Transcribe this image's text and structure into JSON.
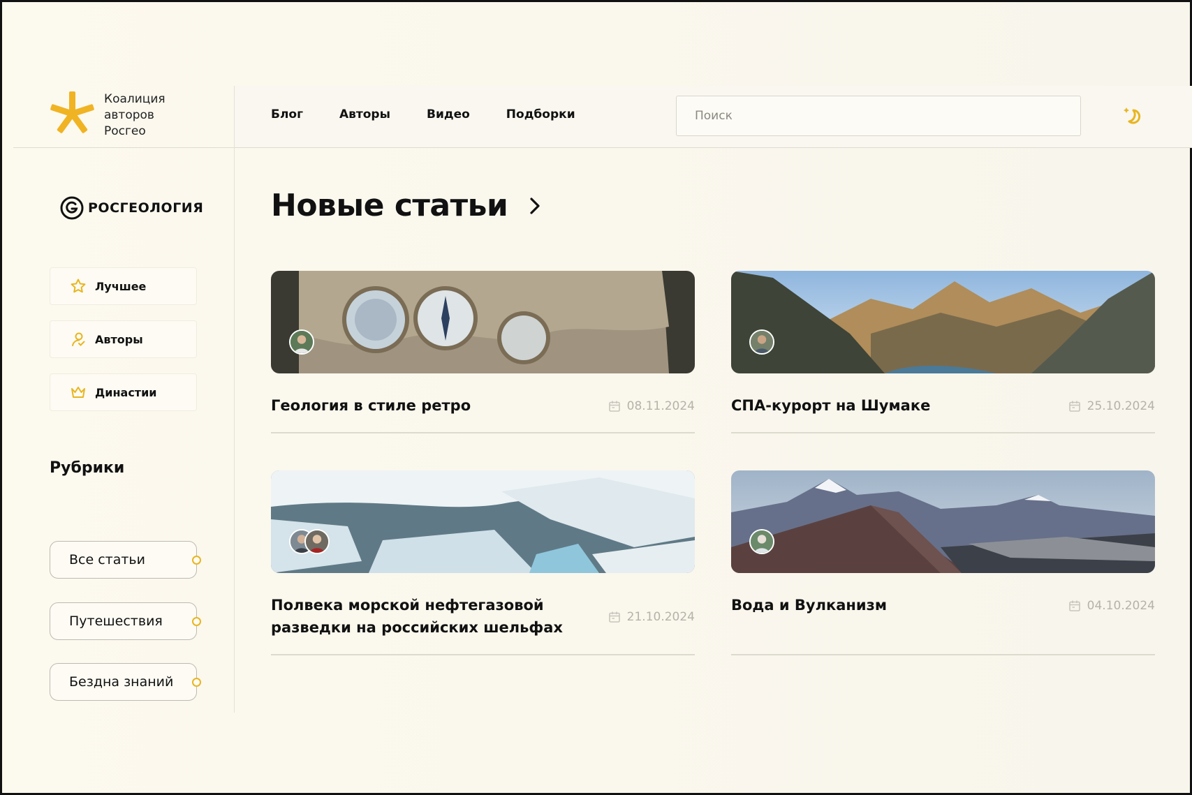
{
  "header": {
    "logo_text": [
      "Коалиция",
      "авторов",
      "Росгео"
    ],
    "nav": [
      {
        "label": "Блог"
      },
      {
        "label": "Авторы"
      },
      {
        "label": "Видео"
      },
      {
        "label": "Подборки"
      }
    ],
    "search": {
      "placeholder": "Поиск",
      "value": ""
    },
    "theme_icon": "moon-star-icon"
  },
  "sidebar": {
    "brand": "РОСГЕОЛОГИЯ",
    "items": [
      {
        "label": "Лучшее",
        "icon": "star-icon"
      },
      {
        "label": "Авторы",
        "icon": "user-icon"
      },
      {
        "label": "Династии",
        "icon": "crown-icon"
      }
    ],
    "rubrics_title": "Рубрики",
    "rubrics": [
      {
        "label": "Все статьи"
      },
      {
        "label": "Путешествия"
      },
      {
        "label": "Бездна знаний"
      }
    ]
  },
  "main": {
    "title": "Новые статьи",
    "articles": [
      {
        "title": "Геология в стиле ретро",
        "date": "08.11.2024",
        "authors": 1
      },
      {
        "title": "СПА-курорт на Шумаке",
        "date": "25.10.2024",
        "authors": 1
      },
      {
        "title": "Полвека морской нефтегазовой разведки на российских шельфах",
        "date": "21.10.2024",
        "authors": 2
      },
      {
        "title": "Вода и Вулканизм",
        "date": "04.10.2024",
        "authors": 1
      }
    ]
  },
  "colors": {
    "accent": "#e8b520",
    "background": "#fbf8ef",
    "text": "#111111",
    "muted": "#b5b2aa"
  }
}
